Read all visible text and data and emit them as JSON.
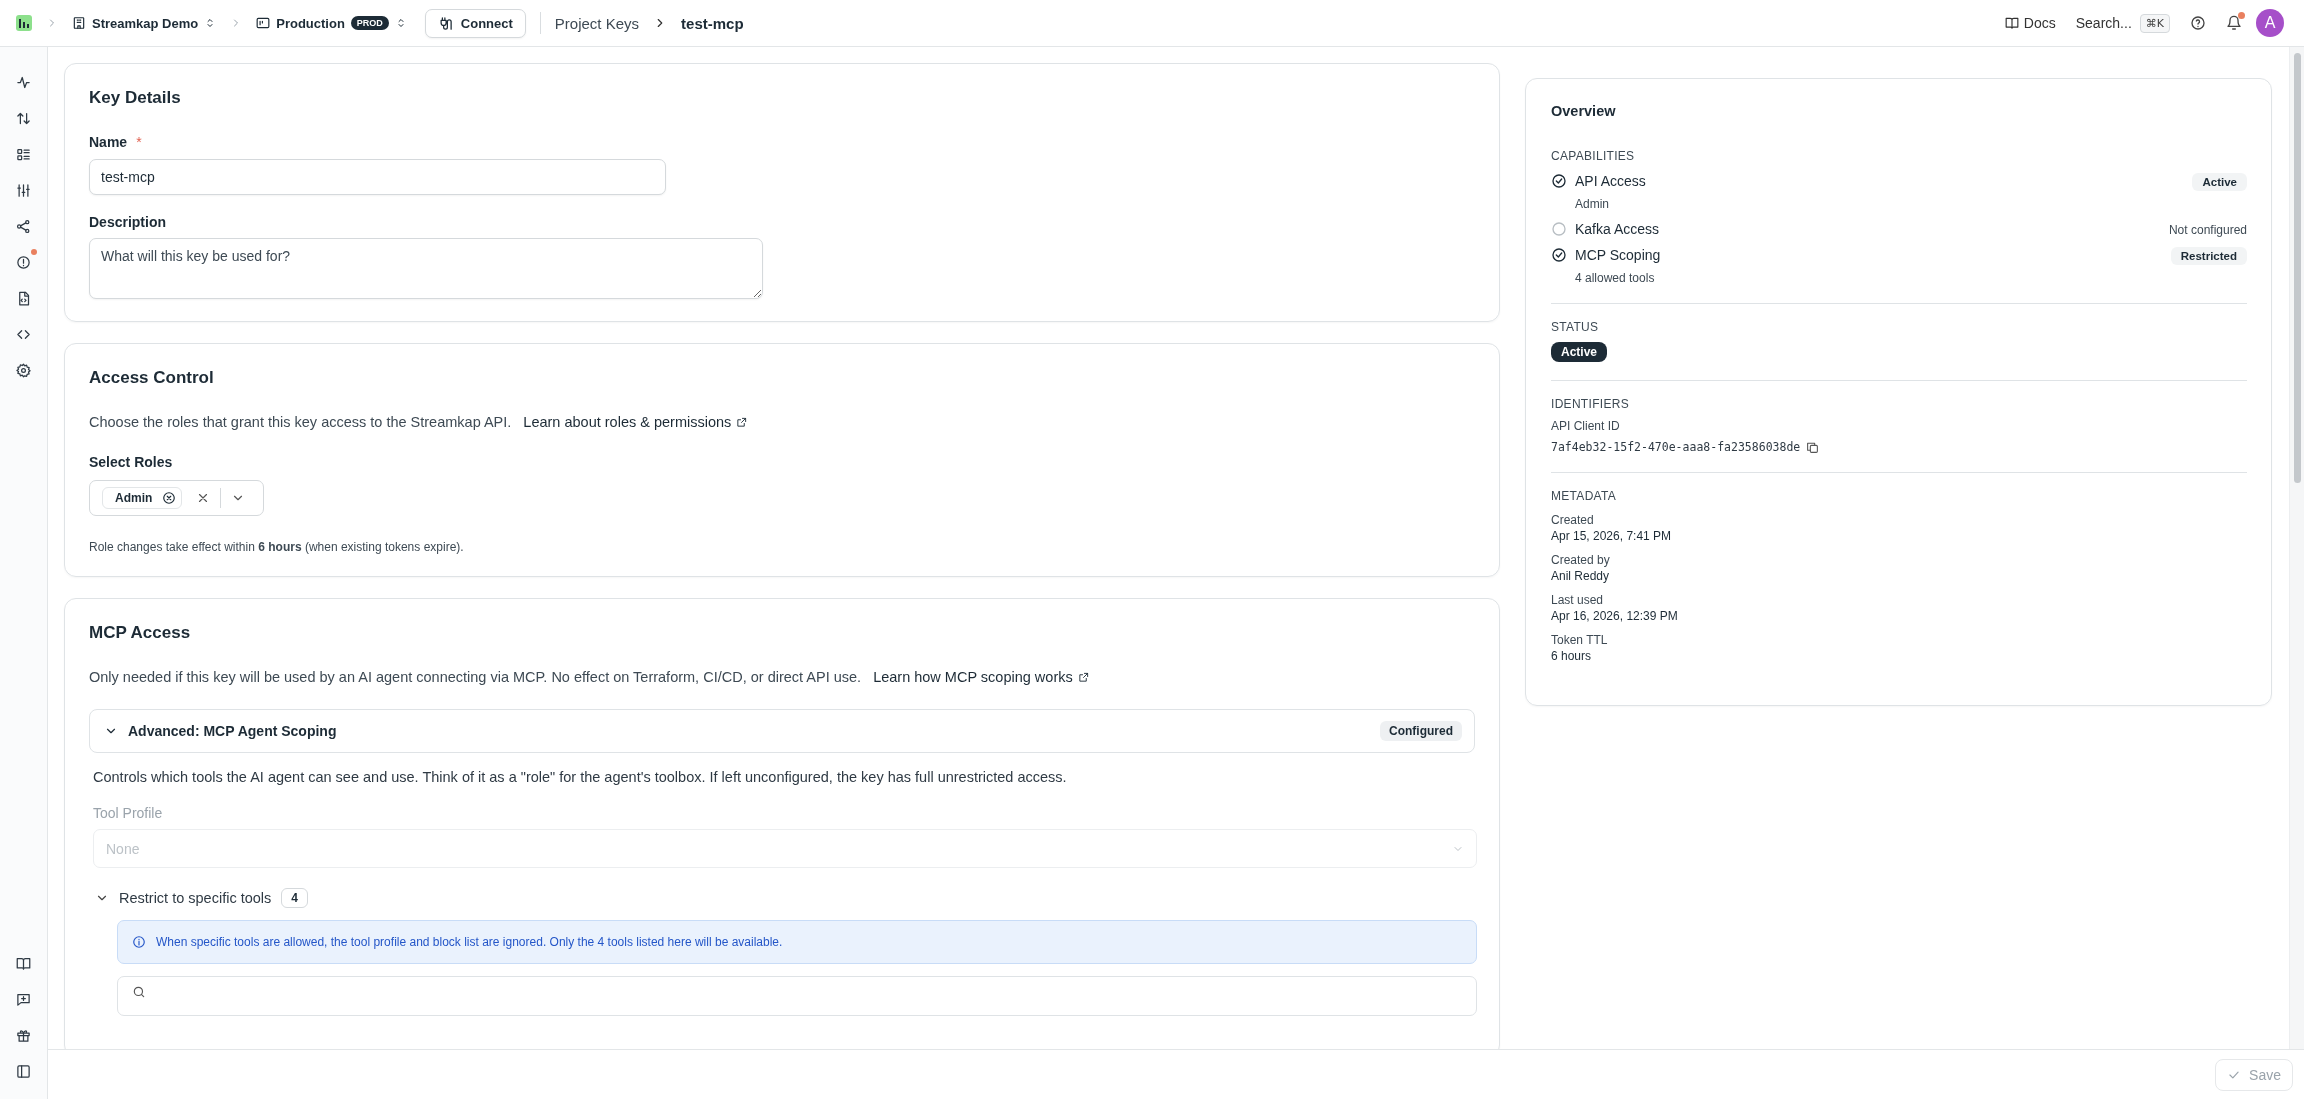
{
  "sidebar": {
    "alert_unread": true
  },
  "topbar": {
    "workspace": "Streamkap Demo",
    "environment": "Production",
    "environment_badge": "PROD",
    "connect_button": "Connect",
    "breadcrumb": [
      "Project Keys",
      "test-mcp"
    ],
    "docs": "Docs",
    "search": "Search...",
    "shortcut": "⌘K",
    "notifications_unread": true,
    "avatar": "A"
  },
  "key_details": {
    "title": "Key Details",
    "name_label": "Name",
    "required_mark": "*",
    "name_value": "test-mcp",
    "description_label": "Description",
    "description_placeholder": "What will this key be used for?"
  },
  "access_control": {
    "title": "Access Control",
    "description": "Choose the roles that grant this key access to the Streamkap API.",
    "link": "Learn about roles & permissions",
    "roles_label": "Select Roles",
    "roles": [
      {
        "label": "Admin"
      }
    ],
    "note": "Role changes take effect within **6 hours** (when existing tokens expire)."
  },
  "mcp_access": {
    "title": "MCP Access",
    "description": "Only needed if this key will be used by an AI agent connecting via MCP. No effect on Terraform, CI/CD, or direct API use.",
    "link": "Learn how MCP scoping works",
    "scoping": {
      "title": "Advanced: MCP Agent Scoping",
      "expanded": true,
      "badge": "Configured",
      "explanation": "Controls which tools the AI agent can see and use. Think of it as a \"role\" for the agent's toolbox. If left unconfigured, the key has full unrestricted access.",
      "tool_profile_label": "Tool Profile",
      "tool_profile_placeholder": "None",
      "tool_profile_disabled": true,
      "restrict": {
        "label": "Restrict to specific tools",
        "expanded": true,
        "count": "4",
        "info": "When specific tools are allowed, the tool profile and block list are ignored. Only the 4 tools listed here will be available."
      }
    }
  },
  "overview": {
    "title": "Overview",
    "capabilities_label": "CAPABILITIES",
    "capabilities": [
      {
        "name": "API Access",
        "checked": true,
        "detail": "Admin",
        "status": "Active",
        "kind": "badge"
      },
      {
        "name": "Kafka Access",
        "checked": false,
        "status": "Not configured",
        "kind": "plain"
      },
      {
        "name": "MCP Scoping",
        "checked": true,
        "detail": "4 allowed tools",
        "status": "Restricted",
        "kind": "badge"
      }
    ],
    "status_label": "STATUS",
    "status": "Active",
    "identifiers_label": "IDENTIFIERS",
    "client_id_label": "API Client ID",
    "client_id": "7af4eb32-15f2-470e-aaa8-fa23586038de",
    "metadata_label": "METADATA",
    "metadata": [
      {
        "label": "Created",
        "value": "Apr 15, 2026, 7:41 PM"
      },
      {
        "label": "Created by",
        "value": "Anil Reddy"
      },
      {
        "label": "Last used",
        "value": "Apr 16, 2026, 12:39 PM"
      },
      {
        "label": "Token TTL",
        "value": "6 hours"
      }
    ]
  },
  "footer": {
    "save_button": "Save",
    "save_disabled": true
  }
}
